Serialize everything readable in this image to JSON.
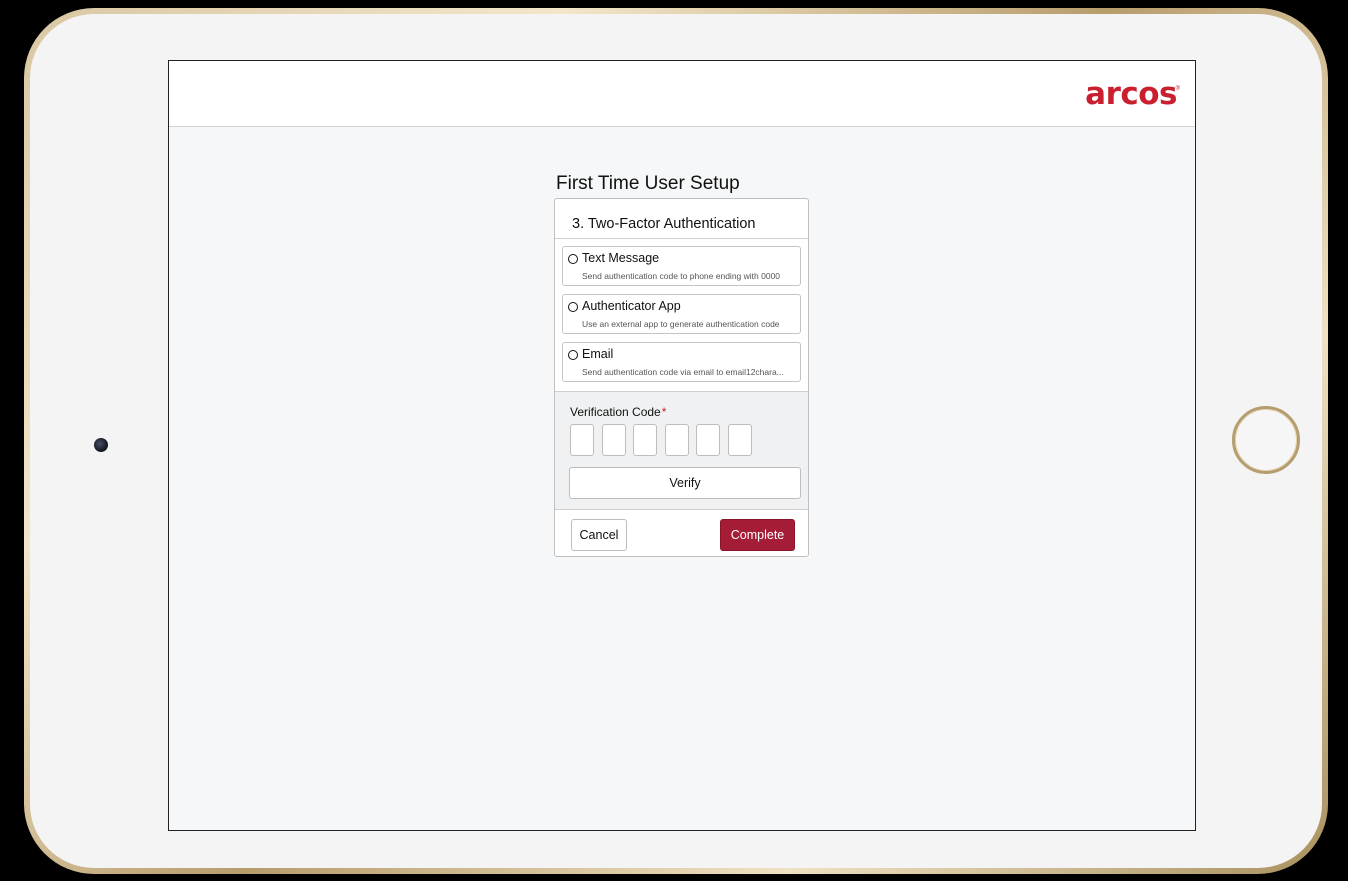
{
  "header": {
    "logo_text": "arcos",
    "logo_mark": "®"
  },
  "setup": {
    "title": "First Time User Setup",
    "step_title": "3. Two-Factor Authentication"
  },
  "options": [
    {
      "label": "Text Message",
      "description": "Send authentication code to phone ending with 0000",
      "selected": false
    },
    {
      "label": "Authenticator App",
      "description": "Use an external app to generate authentication code",
      "selected": false
    },
    {
      "label": "Email",
      "description": "Send authentication code via email to email12chara...",
      "selected": false
    }
  ],
  "verification": {
    "label": "Verification Code",
    "required_mark": "*",
    "digits": [
      "",
      "",
      "",
      "",
      "",
      ""
    ],
    "verify_label": "Verify"
  },
  "footer": {
    "cancel_label": "Cancel",
    "complete_label": "Complete"
  },
  "colors": {
    "brand": "#c8202f",
    "primary_button": "#a51c36"
  }
}
